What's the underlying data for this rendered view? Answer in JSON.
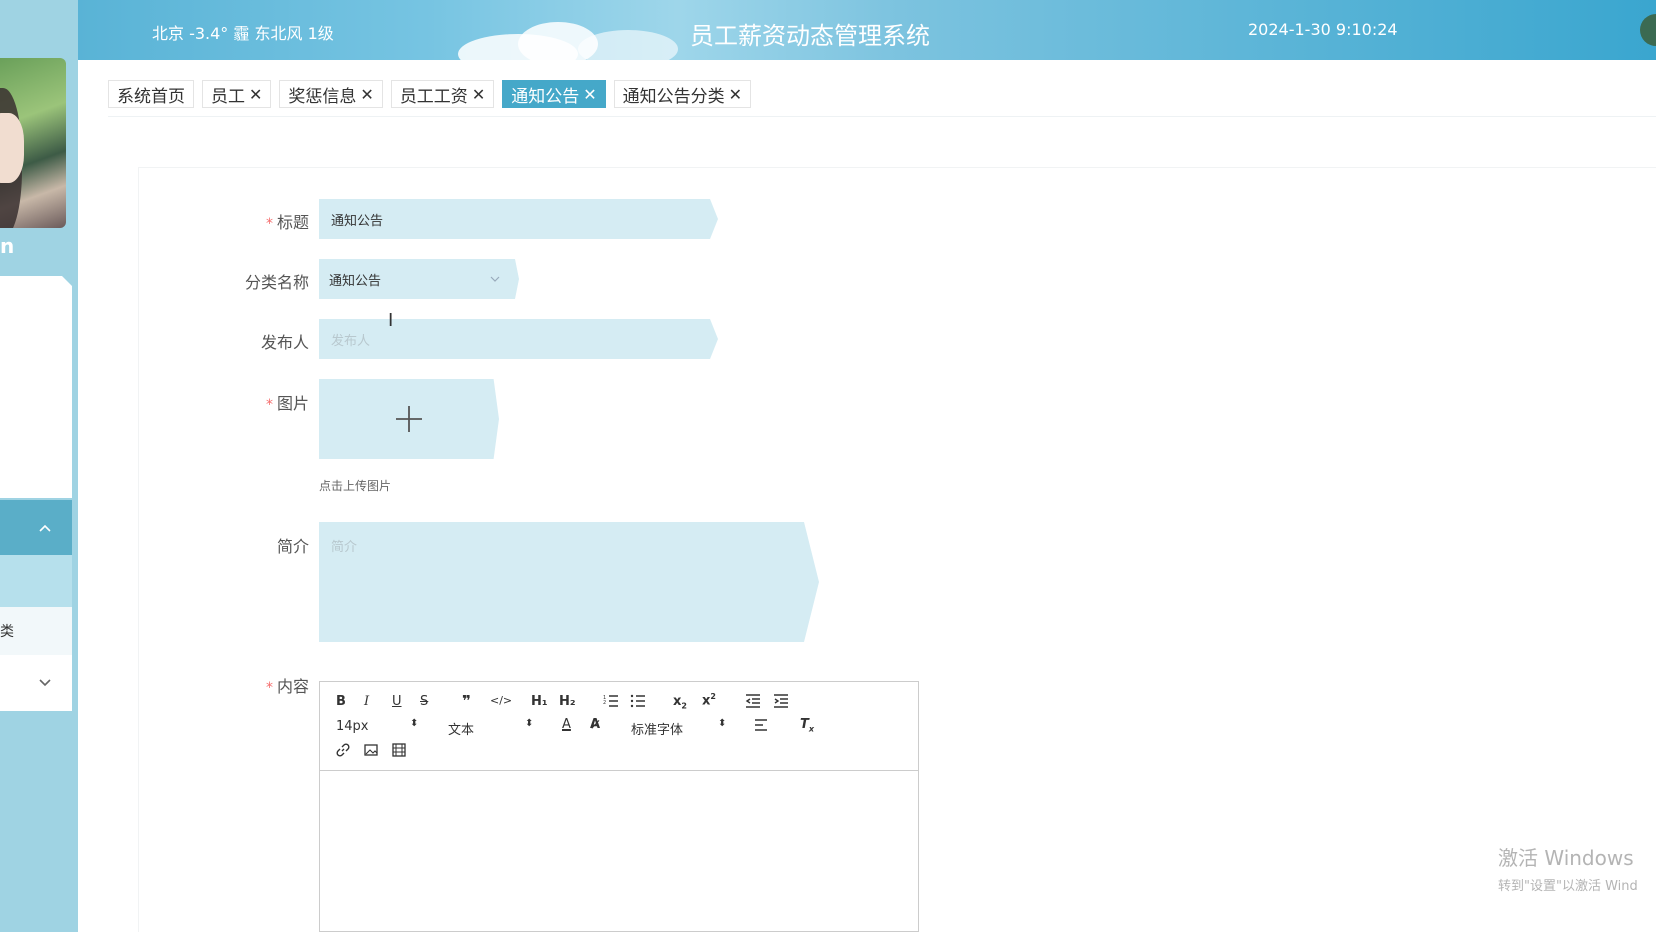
{
  "header": {
    "weather": "北京 -3.4° 霾 东北风 1级",
    "title": "员工薪资动态管理系统",
    "datetime": "2024-1-30 9:10:24"
  },
  "sidebar": {
    "username_partial": "n",
    "menu_item_partial": "类"
  },
  "tabs": [
    {
      "label": "系统首页",
      "closable": false
    },
    {
      "label": "员工",
      "closable": true
    },
    {
      "label": "奖惩信息",
      "closable": true
    },
    {
      "label": "员工工资",
      "closable": true
    },
    {
      "label": "通知公告",
      "closable": true,
      "active": true
    },
    {
      "label": "通知公告分类",
      "closable": true
    }
  ],
  "tab_close_glyph": "✕",
  "form": {
    "title_label": "标题",
    "title_value": "通知公告",
    "category_label": "分类名称",
    "category_value": "通知公告",
    "publisher_label": "发布人",
    "publisher_placeholder": "发布人",
    "image_label": "图片",
    "image_hint": "点击上传图片",
    "intro_label": "简介",
    "intro_placeholder": "简介",
    "content_label": "内容",
    "required_mark": "*"
  },
  "editor": {
    "font_size": "14px",
    "header_select": "文本",
    "font_family": "标准字体",
    "h1": "H₁",
    "h2": "H₂"
  },
  "watermark": {
    "line1": "激活 Windows",
    "line2": "转到\"设置\"以激活 Wind"
  }
}
